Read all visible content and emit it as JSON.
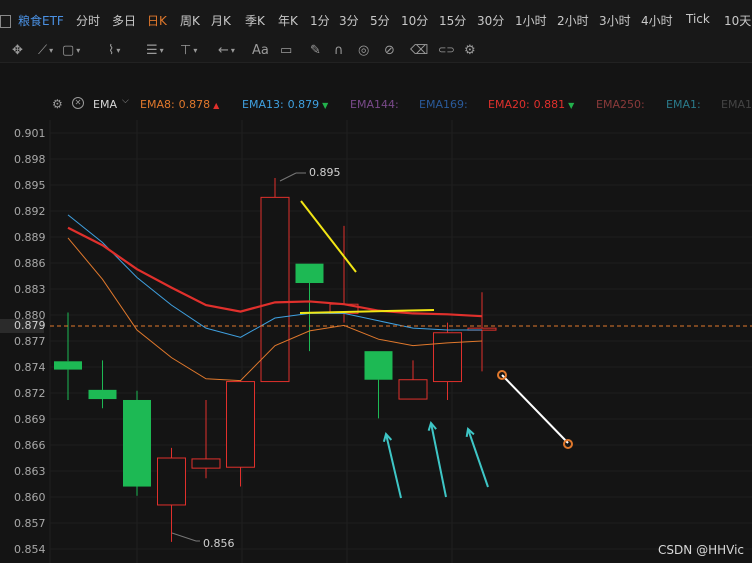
{
  "header": {
    "checkbox_icon": "square-icon",
    "symbol": "粮食ETF",
    "periods": [
      "分时",
      "多日",
      "日K",
      "周K",
      "月K",
      "季K",
      "年K",
      "1分",
      "3分",
      "5分",
      "10分",
      "15分",
      "30分",
      "1小时",
      "2小时",
      "3小时",
      "4小时",
      "Tick",
      "10天"
    ],
    "selected_period": "日K"
  },
  "toolbar": {
    "tools": [
      {
        "icon": "crosshair-icon",
        "caret": false
      },
      {
        "icon": "line-draw-icon",
        "caret": true
      },
      {
        "icon": "shape-square-icon",
        "caret": true
      },
      {
        "icon": "wave-icon",
        "caret": true
      },
      {
        "icon": "fib-icon",
        "caret": true
      },
      {
        "icon": "measure-icon",
        "caret": true
      },
      {
        "icon": "arrow-left-icon",
        "caret": true
      },
      {
        "icon": "text-icon",
        "text": "Aa",
        "caret": false
      },
      {
        "icon": "highlight-icon",
        "caret": false
      },
      {
        "icon": "pencil-icon",
        "caret": false
      },
      {
        "icon": "magnet-icon",
        "caret": false
      },
      {
        "icon": "eye-icon",
        "caret": false
      },
      {
        "icon": "hide-icon",
        "caret": false
      },
      {
        "icon": "trash-icon",
        "caret": false
      },
      {
        "icon": "toggle-icon",
        "caret": false
      },
      {
        "icon": "gear-icon",
        "caret": false
      }
    ]
  },
  "indicator": {
    "name": "EMA",
    "lines": [
      {
        "label": "EMA8:",
        "value": "0.878",
        "arrow": "up",
        "color": "#e0782c",
        "value_color": "#e0782c",
        "arrow_color": "#e0302c"
      },
      {
        "label": "EMA13:",
        "value": "0.879",
        "arrow": "down",
        "color": "#3fa0e0",
        "value_color": "#3fa0e0",
        "arrow_color": "#22b14c"
      },
      {
        "label": "EMA144:",
        "value": "",
        "color": "#7a4a8a"
      },
      {
        "label": "EMA169:",
        "value": "",
        "color": "#2a5a9a"
      },
      {
        "label": "EMA20:",
        "value": "0.881",
        "arrow": "down",
        "color": "#e0302c",
        "value_color": "#e0302c",
        "arrow_color": "#22b14c"
      },
      {
        "label": "EMA250:",
        "value": "",
        "color": "#8a3a3a"
      },
      {
        "label": "EMA1:",
        "value": "",
        "color": "#2a7a8a"
      },
      {
        "label": "EMA1",
        "value": "",
        "color": "#444444"
      }
    ]
  },
  "y_axis": {
    "ticks": [
      "0.901",
      "0.898",
      "0.895",
      "0.892",
      "0.889",
      "0.886",
      "0.883",
      "0.880",
      "0.877",
      "0.874",
      "0.872",
      "0.869",
      "0.866",
      "0.863",
      "0.860",
      "0.857",
      "0.854"
    ],
    "current_price": "0.879"
  },
  "chart_data": {
    "type": "candlestick",
    "up_color": "#e0302c",
    "down_color": "#1db954",
    "ylim": [
      0.8537,
      0.9018
    ],
    "candles": [
      {
        "o": 0.8756,
        "h": 0.8809,
        "l": 0.8714,
        "c": 0.8747
      },
      {
        "o": 0.8725,
        "h": 0.8757,
        "l": 0.8705,
        "c": 0.8715
      },
      {
        "o": 0.8714,
        "h": 0.8724,
        "l": 0.861,
        "c": 0.862
      },
      {
        "o": 0.86,
        "h": 0.8662,
        "l": 0.856,
        "c": 0.8651
      },
      {
        "o": 0.864,
        "h": 0.8714,
        "l": 0.8629,
        "c": 0.865
      },
      {
        "o": 0.8641,
        "h": 0.8735,
        "l": 0.862,
        "c": 0.8734
      },
      {
        "o": 0.8734,
        "h": 0.8955,
        "l": 0.8734,
        "c": 0.8934
      },
      {
        "o": 0.8862,
        "h": 0.8862,
        "l": 0.8767,
        "c": 0.8841
      },
      {
        "o": 0.8808,
        "h": 0.8903,
        "l": 0.8798,
        "c": 0.8818
      },
      {
        "o": 0.8767,
        "h": 0.8767,
        "l": 0.8694,
        "c": 0.8736
      },
      {
        "o": 0.8715,
        "h": 0.8757,
        "l": 0.8715,
        "c": 0.8736
      },
      {
        "o": 0.8734,
        "h": 0.8798,
        "l": 0.8714,
        "c": 0.8787
      },
      {
        "o": 0.8792,
        "h": 0.8831,
        "l": 0.8745,
        "c": 0.8792
      }
    ],
    "series": [
      {
        "name": "EMA13",
        "color": "#3fa0e0",
        "values": [
          0.8915,
          0.8885,
          0.8847,
          0.8817,
          0.8792,
          0.8782,
          0.8803,
          0.8808,
          0.8808,
          0.88,
          0.8792,
          0.879,
          0.879
        ]
      },
      {
        "name": "EMA20",
        "color": "#e0302c",
        "values": [
          0.8901,
          0.8882,
          0.8856,
          0.8836,
          0.8817,
          0.881,
          0.882,
          0.8821,
          0.8818,
          0.8811,
          0.8808,
          0.8807,
          0.8805
        ]
      },
      {
        "name": "EMA8",
        "color": "#e0782c",
        "values": [
          0.889,
          0.8845,
          0.879,
          0.876,
          0.8737,
          0.8735,
          0.8773,
          0.8789,
          0.8795,
          0.878,
          0.8773,
          0.8776,
          0.8778
        ]
      }
    ],
    "annotations": {
      "high_label": "0.895",
      "low_label": "0.856"
    }
  },
  "watermark": "CSDN @HHVic"
}
